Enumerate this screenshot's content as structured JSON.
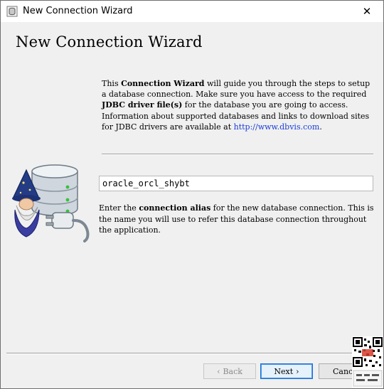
{
  "window": {
    "title": "New Connection Wizard",
    "close_glyph": "✕"
  },
  "page": {
    "heading": "New Connection Wizard",
    "intro": {
      "p1_a": "This ",
      "p1_b": "Connection Wizard",
      "p1_c": " will guide you through the steps to setup a database connection. Make sure you have access to the required ",
      "p1_d": "JDBC driver file(s)",
      "p1_e": " for the database you are going to access.",
      "p2_a": "Information about supported databases and links to download sites for JDBC drivers are available at ",
      "p2_link": "http://www.dbvis.com",
      "p2_end": "."
    },
    "alias_value": "oracle_orcl_shybt",
    "alias_desc": {
      "a": "Enter the ",
      "b": "connection alias",
      "c": " for the new database connection. This is the name you will use to refer this database connection throughout the application."
    }
  },
  "buttons": {
    "back": {
      "label": "Back",
      "arrow": "‹"
    },
    "next": {
      "label": "Next",
      "arrow": "›"
    },
    "cancel": {
      "label": "Cancel"
    }
  },
  "icons": {
    "app": "database-icon",
    "close": "close-icon",
    "wizard": "wizard-database-plug-icon",
    "qr": "qr-code-icon"
  },
  "colors": {
    "link": "#1a3cd8",
    "next_border": "#1f6fd1",
    "window_bg": "#f0f0f0"
  }
}
